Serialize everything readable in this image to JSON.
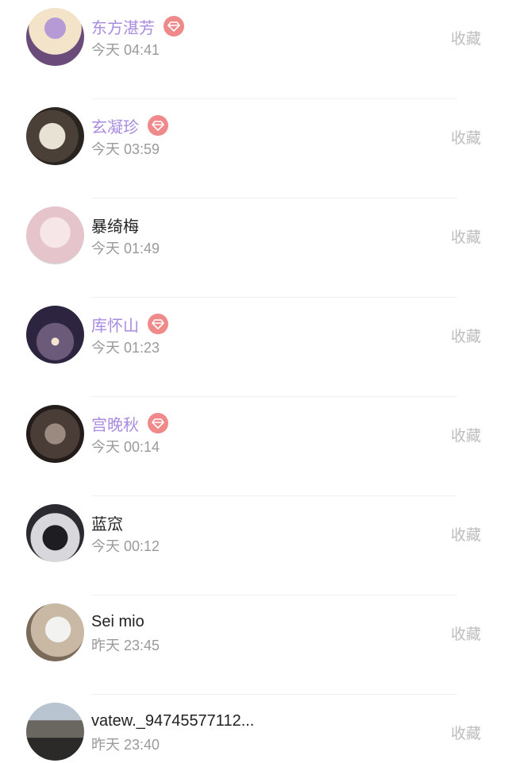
{
  "collect_label": "收藏",
  "badge_icon": "diamond-icon",
  "colors": {
    "vip_name": "#a98be0",
    "badge": "#f08a8a",
    "time": "#9a9a9a",
    "collect": "#bdbdbd"
  },
  "visitors": [
    {
      "name": "东方湛芳",
      "time": "今天 04:41",
      "vip": true
    },
    {
      "name": "玄凝珍",
      "time": "今天 03:59",
      "vip": true
    },
    {
      "name": "暴绮梅",
      "time": "今天 01:49",
      "vip": false
    },
    {
      "name": "库怀山",
      "time": "今天 01:23",
      "vip": true
    },
    {
      "name": "宫晚秋",
      "time": "今天 00:14",
      "vip": true
    },
    {
      "name": "蓝窊",
      "time": "今天 00:12",
      "vip": false
    },
    {
      "name": "Sei mio",
      "time": "昨天 23:45",
      "vip": false
    },
    {
      "name": "vatew._94745577112...",
      "time": "昨天 23:40",
      "vip": false
    }
  ]
}
